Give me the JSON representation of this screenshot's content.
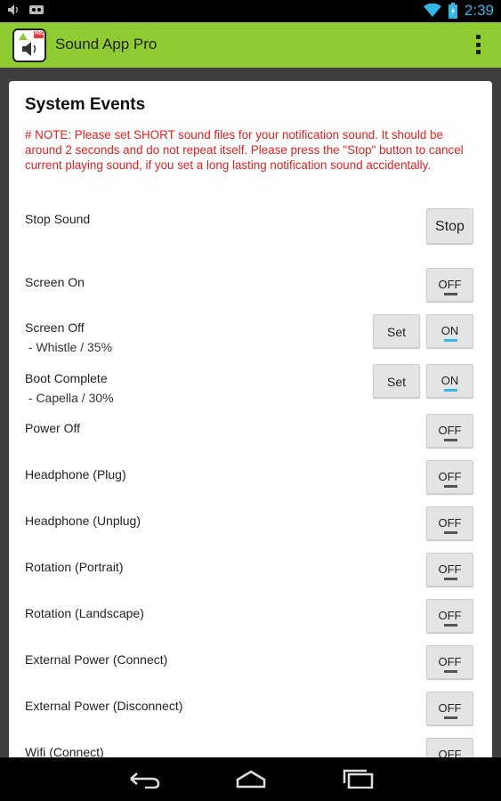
{
  "status_bar": {
    "time": "2:39",
    "icons": [
      "volume-icon",
      "voicemail-icon",
      "wifi-icon",
      "battery-icon"
    ]
  },
  "app_bar": {
    "title": "Sound App Pro",
    "icon": "sound-app-pro-icon",
    "icon_badge": "PRO",
    "menu_icon": "overflow-menu-icon",
    "color": "#8fcc33"
  },
  "section": {
    "title": "System Events",
    "note": "# NOTE: Please set SHORT sound files for your notification sound. It should be around 2 seconds and do not repeat itself. Please press the \"Stop\" button to cancel current playing sound, if you set a long lasting notification sound accidentally.",
    "note_color": "#e02020",
    "stop_sound": {
      "label": "Stop Sound",
      "button": "Stop"
    },
    "set_label": "Set",
    "events": [
      {
        "label": "Screen On",
        "sub": "",
        "state": "OFF"
      },
      {
        "label": "Screen Off",
        "sub": " - Whistle / 35%",
        "state": "ON"
      },
      {
        "label": "Boot Complete",
        "sub": " - Capella / 30%",
        "state": "ON"
      },
      {
        "label": "Power Off",
        "sub": "",
        "state": "OFF"
      },
      {
        "label": "Headphone (Plug)",
        "sub": "",
        "state": "OFF"
      },
      {
        "label": "Headphone (Unplug)",
        "sub": "",
        "state": "OFF"
      },
      {
        "label": "Rotation (Portrait)",
        "sub": "",
        "state": "OFF"
      },
      {
        "label": "Rotation (Landscape)",
        "sub": "",
        "state": "OFF"
      },
      {
        "label": "External Power (Connect)",
        "sub": "",
        "state": "OFF"
      },
      {
        "label": "External Power (Disconnect)",
        "sub": "",
        "state": "OFF"
      },
      {
        "label": "Wifi (Connect)",
        "sub": "",
        "state": "OFF"
      }
    ]
  },
  "nav_bar": {
    "icons": [
      "back-icon",
      "home-icon",
      "recent-apps-icon"
    ]
  }
}
